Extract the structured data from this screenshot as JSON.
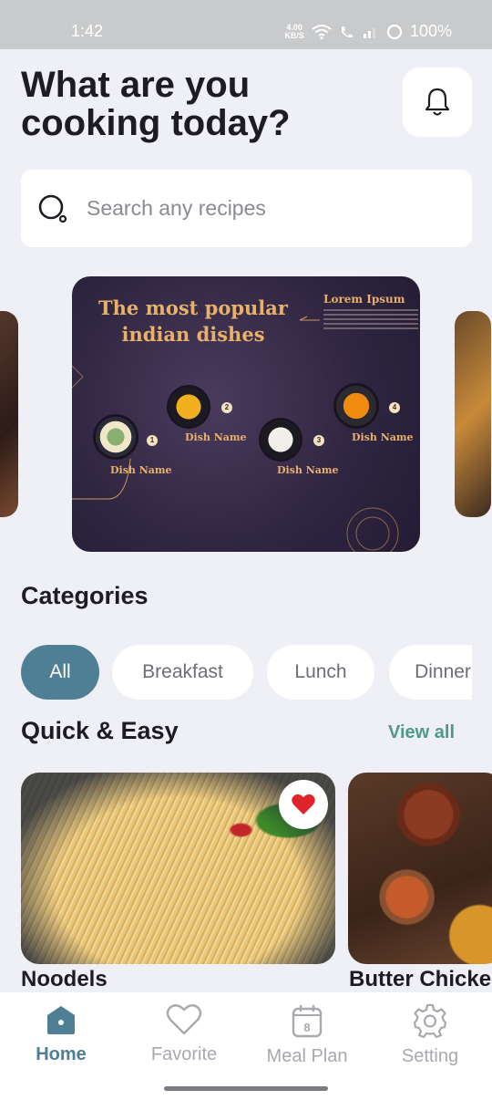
{
  "status_bar": {
    "time": "1:42",
    "speed_value": "4.00",
    "speed_unit": "KB/S",
    "battery": "100%"
  },
  "header": {
    "title_line1": "What are you",
    "title_line2": "cooking today?"
  },
  "search": {
    "placeholder": "Search any recipes"
  },
  "banner": {
    "title_line1": "The most popular",
    "title_line2": "indian dishes",
    "side_heading": "Lorem Ipsum",
    "dishes": [
      {
        "number": "1",
        "name": "Dish Name"
      },
      {
        "number": "2",
        "name": "Dish Name"
      },
      {
        "number": "3",
        "name": "Dish Name"
      },
      {
        "number": "4",
        "name": "Dish Name"
      }
    ]
  },
  "categories": {
    "title": "Categories",
    "items": [
      {
        "label": "All",
        "active": true
      },
      {
        "label": "Breakfast",
        "active": false
      },
      {
        "label": "Lunch",
        "active": false
      },
      {
        "label": "Dinner",
        "active": false
      }
    ]
  },
  "quick_easy": {
    "title": "Quick & Easy",
    "view_all": "View all",
    "recipes": [
      {
        "name": "Noodels",
        "favorited": true
      },
      {
        "name": "Butter Chicken",
        "favorited": false
      }
    ]
  },
  "bottom_nav": {
    "items": [
      {
        "label": "Home",
        "icon": "home-icon",
        "active": true
      },
      {
        "label": "Favorite",
        "icon": "heart-icon",
        "active": false
      },
      {
        "label": "Meal Plan",
        "icon": "calendar-icon",
        "active": false,
        "badge": "8"
      },
      {
        "label": "Setting",
        "icon": "gear-icon",
        "active": false
      }
    ]
  },
  "colors": {
    "accent": "#4f7f94",
    "link": "#4e9a8a",
    "favorite": "#e0242b",
    "background": "#eef0f5"
  }
}
